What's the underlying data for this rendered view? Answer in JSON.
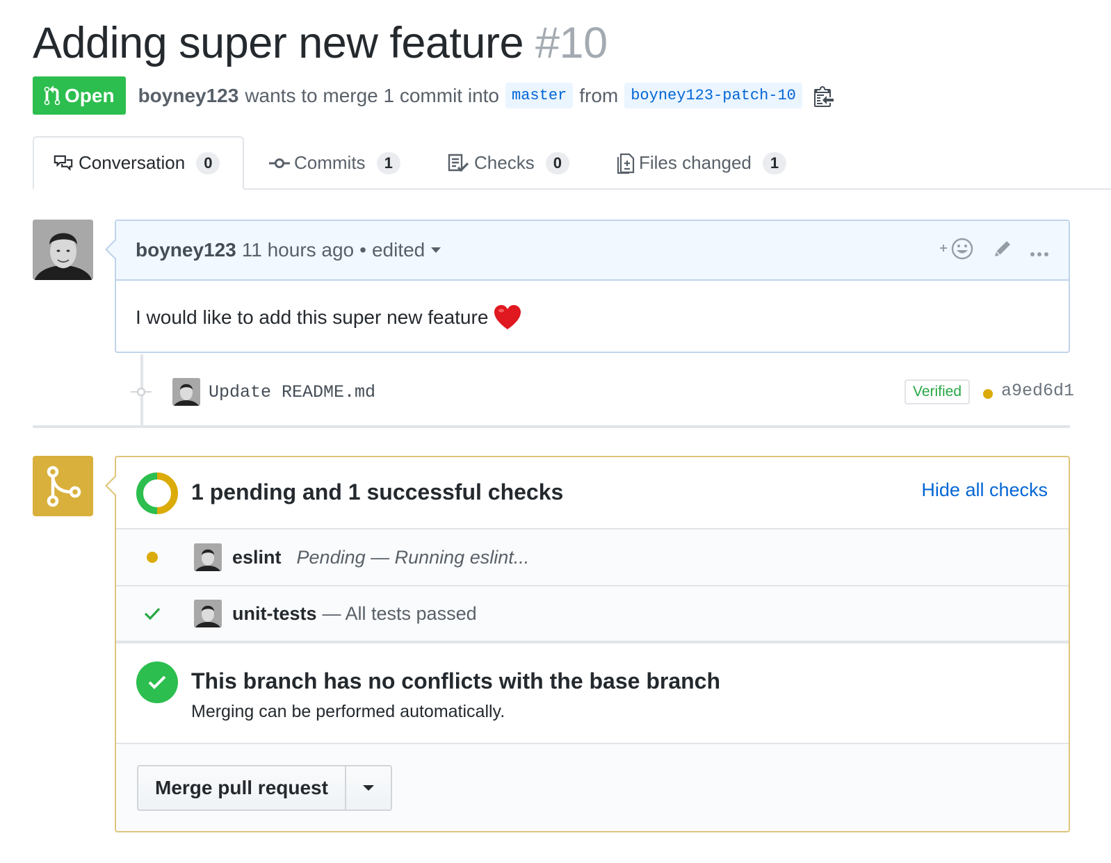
{
  "pr": {
    "title": "Adding super new feature",
    "number": "#10",
    "state": "Open",
    "author": "boyney123",
    "merge_text": "wants to merge 1 commit into",
    "base_branch": "master",
    "from_text": "from",
    "head_branch": "boyney123-patch-10"
  },
  "tabs": [
    {
      "label": "Conversation",
      "count": "0",
      "icon": "comment-discussion-icon"
    },
    {
      "label": "Commits",
      "count": "1",
      "icon": "git-commit-icon"
    },
    {
      "label": "Checks",
      "count": "0",
      "icon": "checklist-icon"
    },
    {
      "label": "Files changed",
      "count": "1",
      "icon": "diff-icon"
    }
  ],
  "comment": {
    "author": "boyney123",
    "time": "11 hours ago",
    "separator": "•",
    "edited": "edited",
    "body": "I would like to add this super new feature"
  },
  "commit": {
    "message": "Update README.md",
    "verified": "Verified",
    "sha": "a9ed6d1"
  },
  "checks": {
    "summary": "1 pending and 1 successful checks",
    "hide_link": "Hide all checks",
    "items": [
      {
        "name": "eslint",
        "status": "pending",
        "description": "Pending — Running eslint..."
      },
      {
        "name": "unit-tests",
        "status": "success",
        "description": "— All tests passed"
      }
    ]
  },
  "merge": {
    "conflict_title": "This branch has no conflicts with the base branch",
    "conflict_subtitle": "Merging can be performed automatically.",
    "button_label": "Merge pull request"
  },
  "colors": {
    "open_green": "#2cbe4e",
    "pending_yellow": "#dbab09",
    "link_blue": "#0366d6",
    "merge_icon_bg": "#d8b03b"
  }
}
